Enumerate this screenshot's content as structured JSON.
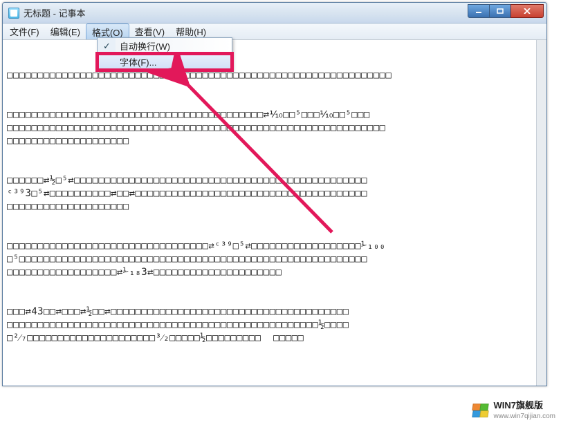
{
  "window": {
    "title": "无标题 - 记事本"
  },
  "menubar": {
    "items": [
      {
        "label": "文件(F)"
      },
      {
        "label": "编辑(E)"
      },
      {
        "label": "格式(O)"
      },
      {
        "label": "查看(V)"
      },
      {
        "label": "帮助(H)"
      }
    ],
    "active_index": 2
  },
  "dropdown": {
    "items": [
      {
        "label": "自动换行(W)",
        "checked": true,
        "highlight": false
      },
      {
        "label": "字体(F)...",
        "checked": false,
        "highlight": true
      }
    ]
  },
  "content_lines": [
    "□□□□□□□□□□□□□□□□□□□□□□□□□□□□□□□□□□□□□□□□□□□□□□□□□□□□□□□□□□□□□□□",
    "",
    "",
    "□□□□□□□□□□□□□□□□□□□□□□□□□□□□□□□□□□□□□□□□□□⇄⅒□□⁵□□□⅒□□⁵□□□",
    "□□□□□□□□□□□□□□□□□□□□□□□□□□□□□□□□□□□□□□□□□□□□□□□□□□□□□□□□□□□□□□",
    "□□□□□□□□□□□□□□□□□□□□",
    "",
    "",
    "□□□□□□⇄½□⁵⇄□□□□□□□□□□□□□□□□□□□□□□□□□□□□□□□□□□□□□□□□□□□□□□□□",
    "ᶜ³⁹3□⁵⇄□□□□□□□□□□⇄□□⇄□□□□□□□□□□□□□□□□□□□□□□□□□□□□□□□□□□□□□□",
    "□□□□□□□□□□□□□□□□□□□□",
    "",
    "",
    "□□□□□□□□□□□□□□□□□□□□□□□□□□□□□□□□□⇄ᶜ³⁹□⁵⇄□□□□□□□□□□□□□□□□□□⅟₁₀₀",
    "□⁵□□□□□□□□□□□□□□□□□□□□□□□□□□□□□□□□□□□□□□□□□□□□□□□□□□□□□□□□□",
    "□□□□□□□□□□□□□□□□□□⇄⅟₁₈3⇄□□□□□□□□□□□□□□□□□□□□□",
    "",
    "",
    "□□□⇄43□□⇄□□□⇄½□□⇄□□□□□□□□□□□□□□□□□□□□□□□□□□□□□□□□□□□□□□□",
    "□□□□□□□□□□□□□□□□□□□□□□□□□□□□□□□□□□□□□□□□□□□□□□□□□□□½□□□□",
    "□²⁄₇□□□□□□□□□□□□□□□□□□□□□³⁄₂□□□□□½□□□□□□□□□  □□□□□"
  ],
  "watermark": {
    "line1": "WIN7旗舰版",
    "line2": "www.win7qijian.com"
  },
  "annotation": {
    "highlight_box_color": "#e2185a",
    "arrow_color": "#e2185a"
  }
}
